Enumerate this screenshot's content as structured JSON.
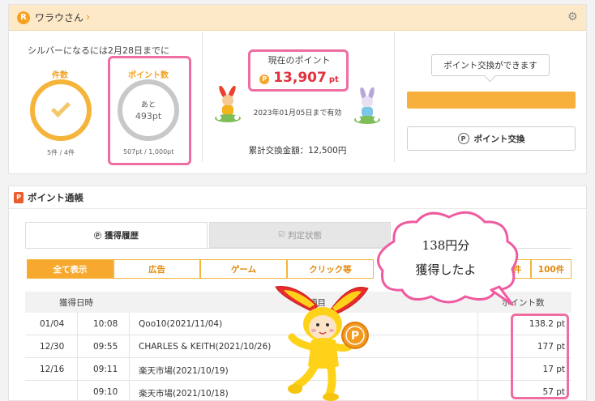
{
  "header": {
    "badge": "R",
    "user_name": "ワラウさん",
    "chevron": "›",
    "settings_icon": "gear-icon"
  },
  "rank": {
    "note": "シルバーになるには2月28日までに",
    "count_gauge": {
      "label": "件数",
      "sub": "5件 / 4件",
      "progress": 1.0
    },
    "point_gauge": {
      "label": "ポイント数",
      "ato": "あと",
      "remaining": "493pt",
      "sub": "507pt / 1,000pt",
      "progress": 0.507
    }
  },
  "points": {
    "label": "現在のポイント",
    "coin": "P",
    "value": "13,907",
    "unit": "pt",
    "expiry": "2023年01月05日まで有効",
    "total_exchange": "累計交換金額：12,500円"
  },
  "exchange": {
    "tooltip": "ポイント交換ができます",
    "button_label": "ポイント交換",
    "button_icon": "P"
  },
  "passbook": {
    "badge": "P",
    "title": "ポイント通帳",
    "tabs": [
      {
        "label": "獲得履歴",
        "icon": "Ⓟ"
      },
      {
        "label": "判定状態",
        "icon": "☑"
      }
    ],
    "filters": [
      "全て表示",
      "広告",
      "ゲーム",
      "クリック等",
      "件",
      "100件"
    ],
    "columns": {
      "date": "獲得日時",
      "item": "項目",
      "points": "ポイント数"
    },
    "rows": [
      {
        "date": "01/04",
        "time": "10:08",
        "item": "Qoo10(2021/11/04)",
        "points": "138.2 pt"
      },
      {
        "date": "12/30",
        "time": "09:55",
        "item": "CHARLES & KEITH(2021/10/26)",
        "points": "177 pt"
      },
      {
        "date": "12/16",
        "time": "09:11",
        "item": "楽天市場(2021/10/19)",
        "points": "17 pt"
      },
      {
        "date": "",
        "time": "09:10",
        "item": "楽天市場(2021/10/18)",
        "points": "57 pt"
      }
    ]
  },
  "overlay": {
    "bubble_line1": "138円分",
    "bubble_line2": "獲得したよ",
    "mascot_coin": "P"
  }
}
